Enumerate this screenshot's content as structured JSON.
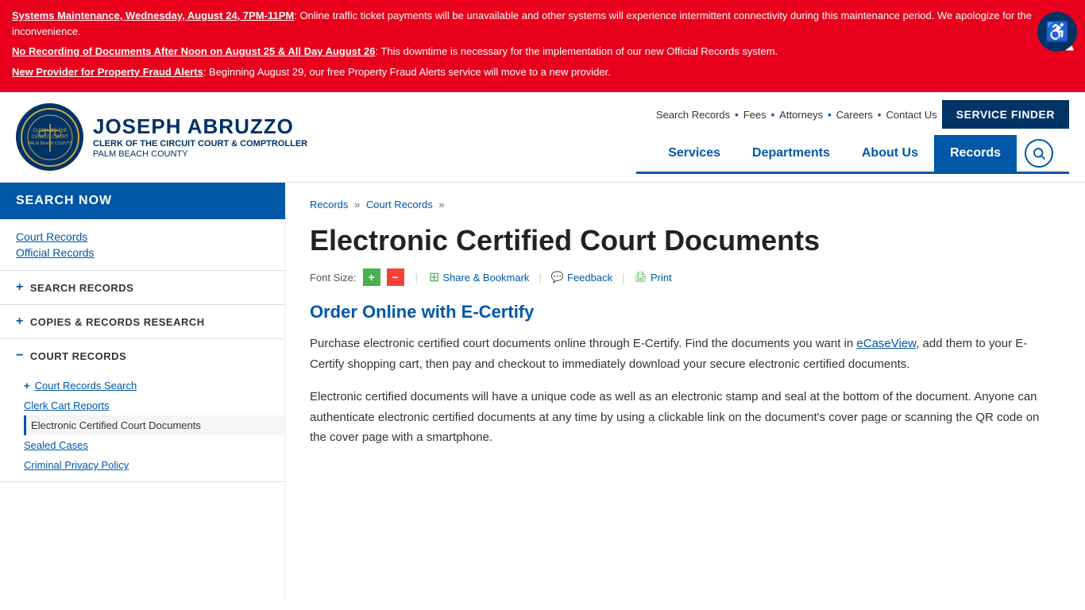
{
  "alerts": [
    {
      "id": "alert-1",
      "bold_part": "Systems Maintenance, Wednesday, August 24, 7PM-11PM",
      "rest": ": Online traffic ticket payments will be unavailable and other systems will experience intermittent connectivity during this maintenance period. We apologize for the inconvenience."
    },
    {
      "id": "alert-2",
      "bold_part": "No Recording of Documents After Noon on August 25 & All Day August 26",
      "rest": ": This downtime is necessary for the implementation of our new Official Records system."
    },
    {
      "id": "alert-3",
      "bold_part": "New Provider for Property Fraud Alerts",
      "rest": ": Beginning August 29, our free Property Fraud Alerts service will move to a new provider."
    }
  ],
  "header": {
    "name_line1": "JOSEPH ABRUZZO",
    "name_line2": "CLERK OF THE CIRCUIT COURT & COMPTROLLER",
    "name_line3": "PALM BEACH COUNTY",
    "service_finder_label": "SERVICE FINDER"
  },
  "top_nav": {
    "items": [
      {
        "label": "Search Records",
        "href": "#"
      },
      {
        "label": "Fees",
        "href": "#"
      },
      {
        "label": "Attorneys",
        "href": "#"
      },
      {
        "label": "Careers",
        "href": "#"
      },
      {
        "label": "Contact Us",
        "href": "#"
      }
    ]
  },
  "main_nav": {
    "items": [
      {
        "label": "Services",
        "active": false
      },
      {
        "label": "Departments",
        "active": false
      },
      {
        "label": "About Us",
        "active": false
      },
      {
        "label": "Records",
        "active": true
      }
    ]
  },
  "sidebar": {
    "search_now_label": "SEARCH NOW",
    "quick_links": [
      {
        "label": "Court Records",
        "href": "#"
      },
      {
        "label": "Official Records",
        "href": "#"
      }
    ],
    "sections": [
      {
        "id": "search-records",
        "label": "SEARCH RECORDS",
        "expanded": false,
        "icon": "+"
      },
      {
        "id": "copies-records",
        "label": "COPIES & RECORDS RESEARCH",
        "expanded": false,
        "icon": "+"
      },
      {
        "id": "court-records",
        "label": "COURT RECORDS",
        "expanded": true,
        "icon": "−",
        "sub_items": [
          {
            "label": "Court Records Search",
            "has_expand": true,
            "active": false
          },
          {
            "label": "Clerk Cart Reports",
            "has_expand": false,
            "active": false
          },
          {
            "label": "Electronic Certified Court Documents",
            "has_expand": false,
            "active": true
          },
          {
            "label": "Sealed Cases",
            "has_expand": false,
            "active": false
          },
          {
            "label": "Criminal Privacy Policy",
            "has_expand": false,
            "active": false
          }
        ]
      }
    ]
  },
  "breadcrumb": {
    "items": [
      {
        "label": "Records",
        "href": "#"
      },
      {
        "label": "Court Records",
        "href": "#"
      }
    ],
    "separator": "»"
  },
  "main": {
    "page_title": "Electronic Certified Court Documents",
    "font_size_label": "Font Size:",
    "share_label": "Share & Bookmark",
    "feedback_label": "Feedback",
    "print_label": "Print",
    "section_title": "Order Online with E-Certify",
    "body_paragraphs": [
      "Purchase electronic certified court documents online through E-Certify. Find the documents you want in eCaseView, add them to your E-Certify shopping cart, then pay and checkout to immediately download your secure electronic certified documents.",
      "Electronic certified documents will have a unique code as well as an electronic stamp and seal at the bottom of the document. Anyone can authenticate electronic certified documents at any time by using a clickable link on the document's cover page or scanning the QR code on the cover page with a smartphone."
    ],
    "ecaseview_link": "eCaseView"
  }
}
